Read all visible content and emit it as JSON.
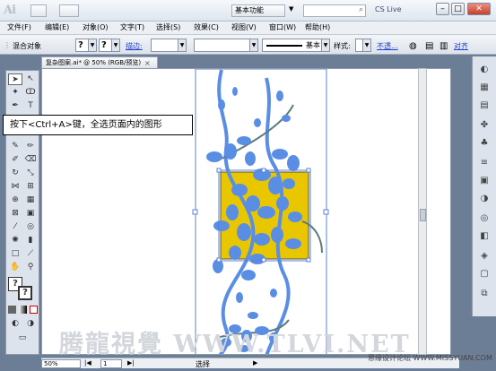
{
  "window": {
    "app_logo": "Ai",
    "workspace": "基本功能",
    "search_placeholder": "",
    "cs_live": "CS Live",
    "minimize": "–",
    "maximize": "□",
    "close": "✕"
  },
  "menu": [
    "文件(F)",
    "编辑(E)",
    "对象(O)",
    "文字(T)",
    "选择(S)",
    "效果(C)",
    "视图(V)",
    "窗口(W)",
    "帮助(H)"
  ],
  "control": {
    "object_type": "混合对象",
    "fill_value": "?",
    "stroke_value": "?",
    "stroke_label": "描边:",
    "brush_label": "基本",
    "style_label": "样式:",
    "opacity_label": "不透...",
    "align_label": "对齐"
  },
  "document": {
    "tab_title": "复杂图案.ai* @ 50% (RGB/预览)",
    "tab_close": "×"
  },
  "callout_text": "按下<Ctrl+A>键，全选页面内的图形",
  "status": {
    "zoom": "50%",
    "page": "1",
    "selection": "选择"
  },
  "watermark": {
    "brand": "腾龍視覺 WWW.TLVI.NET",
    "site": "思缘设计论坛 WWW.MISSYUAN.COM"
  },
  "colors": {
    "pattern_blue": "#5a8ee4",
    "square_yellow": "#e8c700",
    "selection_blue": "#5b80d2",
    "stem_gray": "#5e7b7e"
  }
}
